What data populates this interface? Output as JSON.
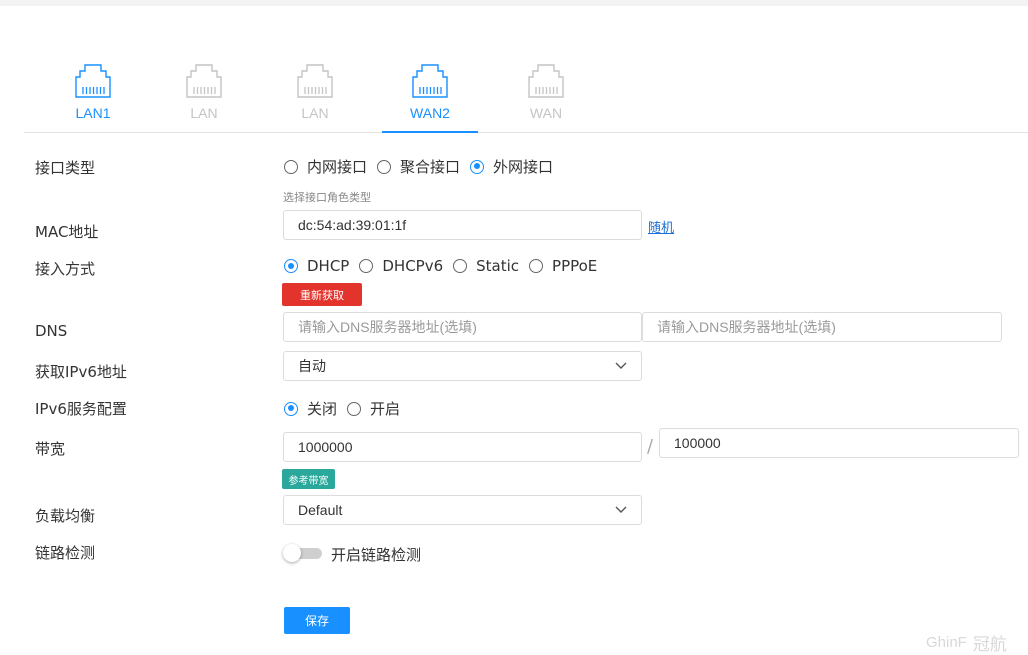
{
  "ports": [
    {
      "label": "LAN1",
      "active": true,
      "icon": "ethernet-port-icon"
    },
    {
      "label": "LAN",
      "active": false,
      "icon": "ethernet-port-icon"
    },
    {
      "label": "LAN",
      "active": false,
      "icon": "ethernet-port-icon"
    },
    {
      "label": "WAN2",
      "active": true,
      "selected": true,
      "icon": "ethernet-port-icon"
    },
    {
      "label": "WAN",
      "active": false,
      "icon": "ethernet-port-icon"
    }
  ],
  "form": {
    "interface_type": {
      "label": "接口类型",
      "options": [
        "内网接口",
        "聚合接口",
        "外网接口"
      ],
      "selected": "外网接口",
      "hint": "选择接口角色类型"
    },
    "mac": {
      "label": "MAC地址",
      "value": "dc:54:ad:39:01:1f",
      "random_link": "随机"
    },
    "access_mode": {
      "label": "接入方式",
      "options": [
        "DHCP",
        "DHCPv6",
        "Static",
        "PPPoE"
      ],
      "selected": "DHCP",
      "refresh_button": "重新获取"
    },
    "dns": {
      "label": "DNS",
      "placeholder1": "请输入DNS服务器地址(选填)",
      "placeholder2": "请输入DNS服务器地址(选填)"
    },
    "ipv6_address": {
      "label": "获取IPv6地址",
      "value": "自动"
    },
    "ipv6_service": {
      "label": "IPv6服务配置",
      "options": [
        "关闭",
        "开启"
      ],
      "selected": "关闭"
    },
    "bandwidth": {
      "label": "带宽",
      "up": "1000000",
      "separator": "/",
      "down": "100000",
      "reference_button": "参考带宽"
    },
    "load_balance": {
      "label": "负载均衡",
      "value": "Default"
    },
    "link_check": {
      "label": "链路检测",
      "toggle_label": "开启链路检测",
      "enabled": false
    },
    "save_button": "保存"
  },
  "watermark": {
    "text": "GhinF",
    "cn": "冠航"
  },
  "colors": {
    "accent": "#1890ff",
    "danger": "#e2342d",
    "teal": "#2aa89b",
    "inactive": "#c4c4c4"
  }
}
